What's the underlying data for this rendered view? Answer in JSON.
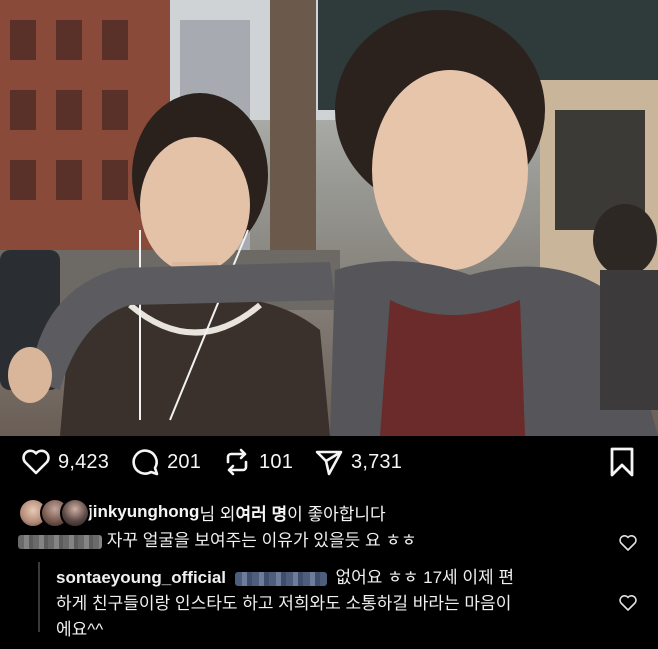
{
  "post": {
    "likes_count": "9,423",
    "comments_count": "201",
    "reposts_count": "101",
    "shares_count": "3,731"
  },
  "likes_line": {
    "username": "jinkyunghong",
    "mid_text": "님 외 ",
    "bold_text": "여러 명",
    "tail_text": "이 좋아합니다"
  },
  "comments": [
    {
      "username": "",
      "text": "자꾸 얼굴을 보여주는 이유가 있을듯 요 ㅎㅎ"
    }
  ],
  "reply": {
    "username": "sontaeyoung_official",
    "line1": "없어요 ㅎㅎ 17세 이제 편",
    "line2": "하게 친구들이랑 인스타도 하고 저희와도 소통하길 바라는 마음이",
    "line3": "에요^^"
  },
  "icons": [
    "heart-icon",
    "comment-icon",
    "repost-icon",
    "share-icon",
    "bookmark-icon"
  ],
  "colors": {
    "background": "#000000",
    "text": "#f5f5f5"
  }
}
